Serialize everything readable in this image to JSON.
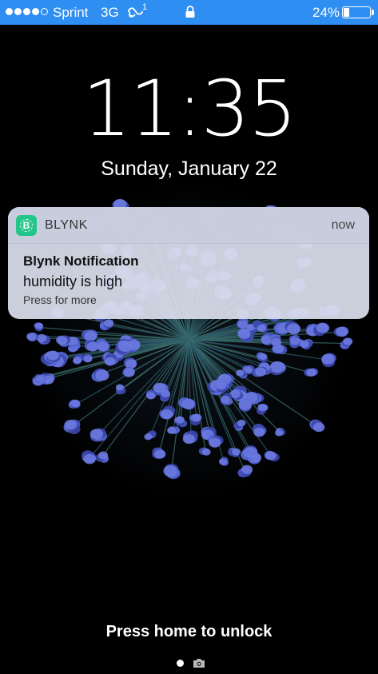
{
  "status_bar": {
    "carrier": "Sprint",
    "network": "3G",
    "link_superscript": "1",
    "battery_percent_text": "24%",
    "battery_level": 0.24,
    "signal_bars_filled": 4,
    "signal_bars_total": 5,
    "background_color": "#2f8ef2"
  },
  "lock_screen": {
    "time": "11:35",
    "date": "Sunday, January 22",
    "unlock_hint": "Press home to unlock"
  },
  "notification": {
    "app_icon_letter": "B",
    "app_name": "BLYNK",
    "time": "now",
    "title": "Blynk Notification",
    "body": "humidity is high",
    "more": "Press for more",
    "app_icon_color": "#22c58a"
  },
  "icons": {
    "lock": "lock-icon",
    "link": "link-icon",
    "camera": "camera-icon"
  }
}
